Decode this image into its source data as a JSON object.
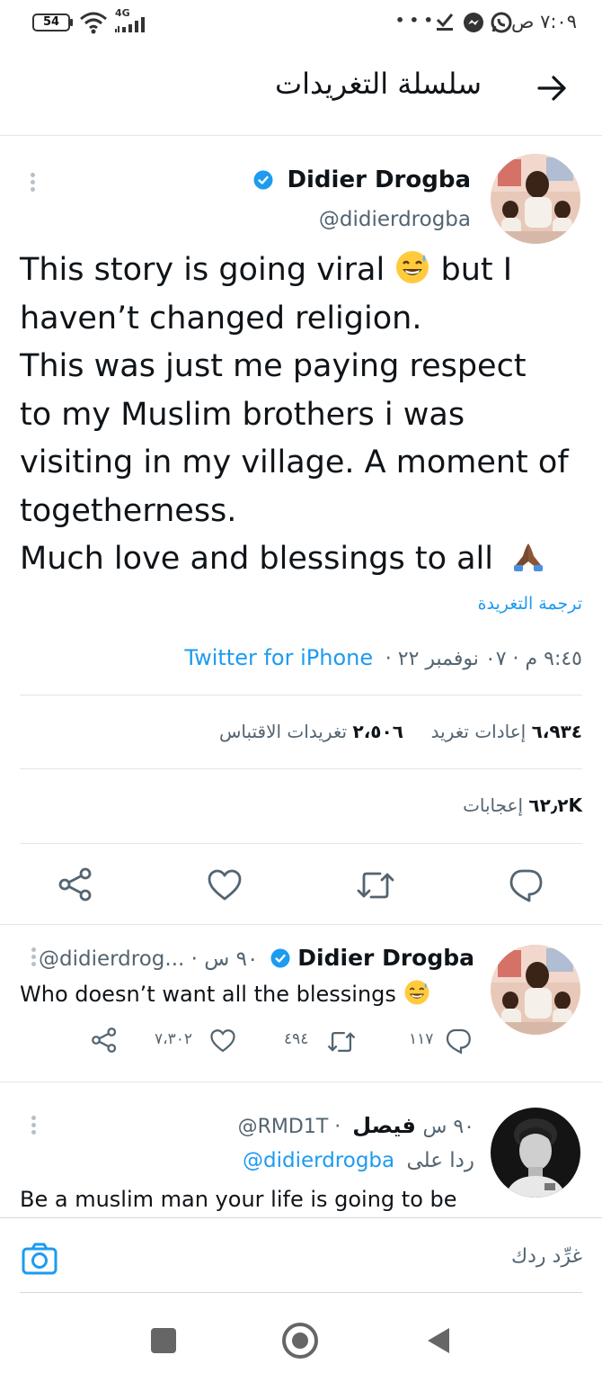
{
  "status_bar": {
    "time": "٧:٠٩ ص",
    "battery": "54",
    "network": "4G",
    "dots": "• • •"
  },
  "header": {
    "title": "سلسلة التغريدات"
  },
  "main_tweet": {
    "name": "Didier Drogba",
    "handle": "@didierdrogba",
    "text_line1": "This story is going viral",
    "text_line1b": "but I",
    "text_rest": "haven’t changed religion.\nThis was just me paying respect\nto my Muslim brothers i was\nvisiting in my village. A moment of\ntogetherness.\nMuch love and blessings to all",
    "translate": "ترجمة التغريدة",
    "meta_time": "٩:٤٥ م · ٠٧ نوفمبر ٢٢ ·",
    "meta_source": "Twitter for iPhone",
    "retweets_count": "٦،٩٣٤",
    "retweets_label": "إعادات تغريد",
    "quotes_count": "٢،٥٠٦",
    "quotes_label": "تغريدات الاقتباس",
    "likes_count": "٦٢٫٢K",
    "likes_label": "إعجابات"
  },
  "reply1": {
    "name": "Didier Drogba",
    "handle_time": "@didierdrog... · ٩٠ س",
    "text": "Who doesn’t want all the blessings",
    "replies": "١١٧",
    "retweets": "٤٩٤",
    "likes": "٧،٣٠٢"
  },
  "reply2": {
    "name": "فيصل",
    "handle_time": "@RMD1T · ٩٠ س",
    "reply_prefix": "ردا على",
    "reply_to": "@didierdrogba",
    "text": "Be a muslim man your life is going to be"
  },
  "composer": {
    "placeholder": "غرِّد ردك"
  },
  "icons": {
    "back": "arrow-right-icon",
    "share": "share-icon",
    "like": "heart-icon",
    "retweet": "retweet-icon",
    "reply": "reply-icon",
    "camera": "camera-icon",
    "verified": "verified-badge-icon"
  },
  "colors": {
    "accent": "#1d9bf0",
    "text": "#0f1419",
    "muted": "#536471"
  }
}
